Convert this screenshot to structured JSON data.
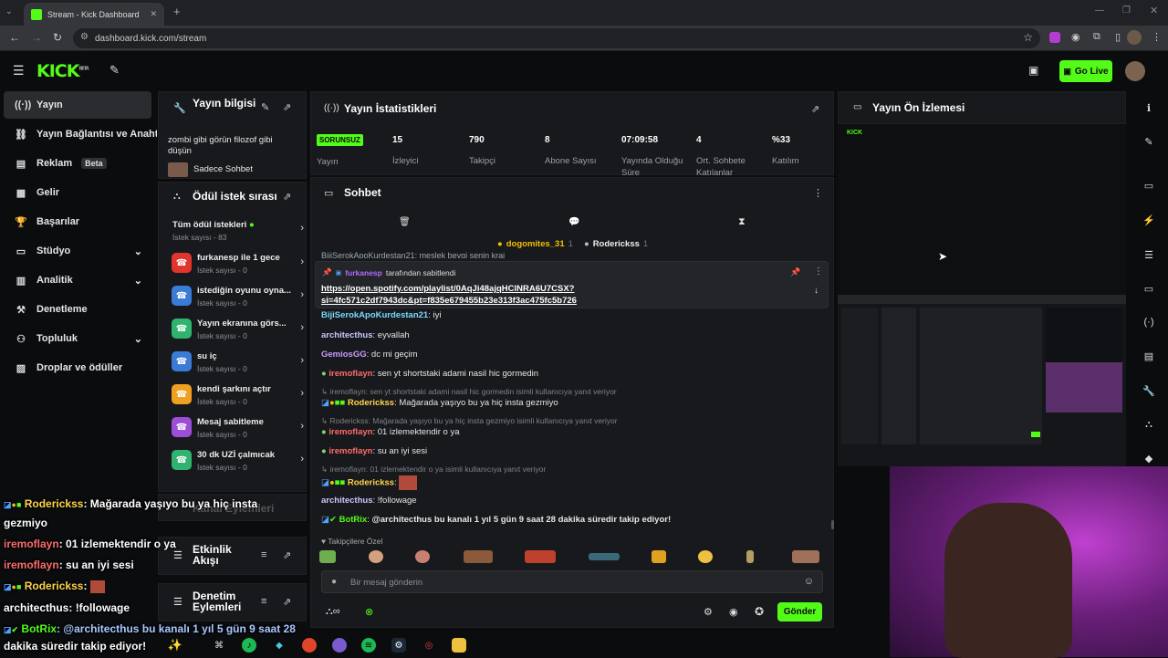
{
  "browser": {
    "tab_title": "Stream - Kick Dashboard",
    "url": "dashboard.kick.com/stream"
  },
  "header": {
    "logo": "KICK",
    "logo_badge": "BETA",
    "go_live": "Go Live"
  },
  "sidebar": {
    "items": [
      {
        "label": "Yayın",
        "icon": "broadcast-icon"
      },
      {
        "label": "Yayın Bağlantısı ve Anahtarı",
        "icon": "link-icon"
      },
      {
        "label": "Reklam",
        "icon": "ad-icon",
        "badge": "Beta"
      },
      {
        "label": "Gelir",
        "icon": "wallet-icon"
      },
      {
        "label": "Başarılar",
        "icon": "trophy-icon"
      },
      {
        "label": "Stüdyo",
        "icon": "studio-icon"
      },
      {
        "label": "Analitik",
        "icon": "chart-icon"
      },
      {
        "label": "Denetleme",
        "icon": "gavel-icon"
      },
      {
        "label": "Topluluk",
        "icon": "community-icon"
      },
      {
        "label": "Droplar ve ödüller",
        "icon": "gift-icon"
      }
    ]
  },
  "stream_info": {
    "title": "Yayın bilgisi",
    "description": "zombi gibi görün filozof gibi düşün",
    "category": "Sadece Sohbet"
  },
  "rewards": {
    "title": "Ödül istek sırası",
    "all_label": "Tüm ödül istekleri",
    "all_count": "İstek sayısı - 83",
    "items": [
      {
        "title": "furkanesp ile 1 gece",
        "sub": "İstek sayısı - 0",
        "color": "#e0342c"
      },
      {
        "title": "istediğin oyunu oyna...",
        "sub": "İstek sayısı - 0",
        "color": "#3a7bd5"
      },
      {
        "title": "Yayın ekranına görs...",
        "sub": "İstek sayısı - 0",
        "color": "#2fb36f"
      },
      {
        "title": "su iç",
        "sub": "İstek sayısı - 0",
        "color": "#3a7bd5"
      },
      {
        "title": "kendi şarkını açtır",
        "sub": "İstek sayısı - 0",
        "color": "#f0a020"
      },
      {
        "title": "Mesaj sabitleme",
        "sub": "İstek sayısı - 0",
        "color": "#9b4fd6"
      },
      {
        "title": "30 dk UZİ çalmıcak",
        "sub": "İstek sayısı - 0",
        "color": "#2fb36f"
      }
    ]
  },
  "lower_panels": {
    "chat_users": "Kanal Eylemleri",
    "activity": "Etkinlik Akışı",
    "mod_actions": "Denetim Eylemleri"
  },
  "stats": {
    "title": "Yayın İstatistikleri",
    "status": "SORUNSUZ",
    "status_label": "Yayın",
    "items": [
      {
        "value": "15",
        "label": "İzleyici"
      },
      {
        "value": "790",
        "label": "Takipçi"
      },
      {
        "value": "8",
        "label": "Abone Sayısı"
      },
      {
        "value": "07:09:58",
        "label": "Yayında Olduğu Süre"
      },
      {
        "value": "4",
        "label": "Ort. Sohbete Katılanlar"
      },
      {
        "value": "%33",
        "label": "Katılım"
      }
    ]
  },
  "chat": {
    "title": "Sohbet",
    "top_users": [
      {
        "name": "dogomites_31",
        "count": "1"
      },
      {
        "name": "Roderickss",
        "count": "1"
      }
    ],
    "cut_line": "BijiSerokApoKurdestan21: meslek beygi senin krai",
    "pinned_by_user": "furkanesp",
    "pinned_by_suffix": "tarafından sabitlendi",
    "pinned_link": "https://open.spotify.com/playlist/0AqJi48ajqHCINRA6U7CSX?si=4fc571c2df7943dc&pt=f835e679455b23e313f3ac475fc5b726",
    "pinned_link_l1": "https://open.spotify.com/playlist/0AqJi48ajqHCINRA6U7CSX?",
    "pinned_link_l2": "si=4fc571c2df7943dc&pt=f835e679455b23e313f3ac475fc5b726",
    "messages": [
      {
        "user": "BijiSerokApoKurdestan21",
        "text": "iyi",
        "color": "#7ad8ff"
      },
      {
        "user": "architecthus",
        "text": "eyvallah",
        "color": "#c8c8ff"
      },
      {
        "user": "GemiosGG",
        "text": "dc mi geçim",
        "color": "#c79cff"
      },
      {
        "user": "iremoflayn",
        "text": "sen yt shortstaki adami nasil hic gormedin",
        "color": "#ff6b6b"
      },
      {
        "reply": "iremoflayn: sen yt shortstaki adami nasil hic gormedin isimli kullanıcıya yanıt veriyor"
      },
      {
        "user": "Roderickss",
        "text": "Mağarada yaşıyo bu ya hiç insta gezmiyo",
        "color": "#ffd54a"
      },
      {
        "reply": "Roderickss: Mağarada yaşıyo bu ya hiç insta gezmiyo isimli kullanıcıya yanıt veriyor"
      },
      {
        "user": "iremoflayn",
        "text": "01 izlemektendir o ya",
        "color": "#ff6b6b"
      },
      {
        "user": "iremoflayn",
        "text": "su an iyi sesi",
        "color": "#ff6b6b"
      },
      {
        "reply": "iremoflayn: 01 izlemektendir o ya isimli kullanıcıya yanıt veriyor"
      },
      {
        "user": "Roderickss",
        "text": "",
        "color": "#ffd54a"
      },
      {
        "user": "architecthus",
        "text": "!followage",
        "color": "#c8c8ff"
      },
      {
        "user": "BotRix",
        "text": "@architecthus bu kanalı 1 yıl 5 gün 9 saat 28 dakika süredir takip ediyor!",
        "color": "#53fc18"
      }
    ],
    "emote_label": "Takipçilere Özel",
    "input_placeholder": "Bir mesaj gönderin",
    "send": "Gönder"
  },
  "preview": {
    "title": "Yayın Ön İzlemesi"
  },
  "overlay_chat": [
    {
      "user": "Roderickss",
      "text": ": Mağarada yaşıyo bu ya hiç insta",
      "color": "#ffd54a"
    },
    {
      "user": "",
      "text": "gezmiyo",
      "color": "#fff"
    },
    {
      "user": "iremoflayn",
      "text": ": 01 izlemektendir o ya",
      "color": "#ff6b6b"
    },
    {
      "user": "iremoflayn",
      "text": ": su an iyi sesi",
      "color": "#ff6b6b"
    },
    {
      "user": "Roderickss",
      "text": ":",
      "color": "#ffd54a"
    },
    {
      "user": "architecthus",
      "text": ": !followage",
      "color": "#fff"
    },
    {
      "user": "BotRix",
      "text": ": @architecthus bu kanalı 1 yıl 5 gün 9 saat 28",
      "color": "#53fc18"
    },
    {
      "user": "",
      "text": "dakika süredir takip ediyor!",
      "color": "#fff"
    }
  ],
  "colors": {
    "accent": "#53fc18",
    "panel": "#18191c",
    "bg": "#0b0c0e"
  }
}
